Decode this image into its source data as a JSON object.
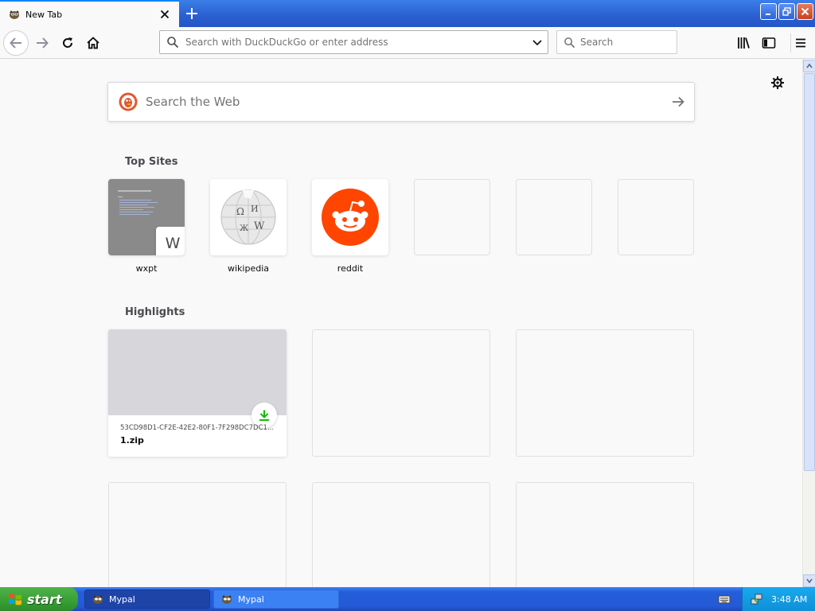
{
  "window": {
    "tab_title": "New Tab"
  },
  "navbar": {
    "url_placeholder": "Search with DuckDuckGo or enter address",
    "search_placeholder": "Search"
  },
  "newtab": {
    "web_search_placeholder": "Search the Web",
    "top_sites_title": "Top Sites",
    "top_sites": [
      {
        "label": "wxpt",
        "badge_letter": "W"
      },
      {
        "label": "wikipedia"
      },
      {
        "label": "reddit"
      }
    ],
    "highlights_title": "Highlights",
    "highlights": [
      {
        "meta": "53CD98D1-CF2E-42E2-80F1-7F298DC7DC1...",
        "filename": "1.zip"
      }
    ]
  },
  "taskbar": {
    "start_label": "start",
    "tasks": [
      {
        "label": "Mypal"
      },
      {
        "label": "Mypal"
      }
    ],
    "clock": "3:48 AM"
  },
  "colors": {
    "accent": "#0a84ff",
    "reddit": "#ff4500",
    "download_green": "#12bc00",
    "xp_blue": "#245edb",
    "xp_green": "#379f34"
  }
}
